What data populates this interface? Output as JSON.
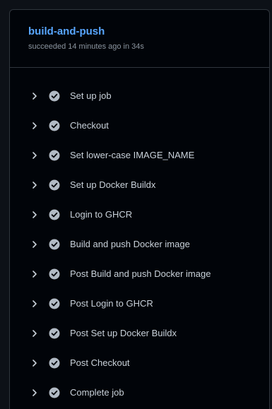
{
  "job": {
    "title": "build-and-push",
    "status": "succeeded 14 minutes ago in 34s"
  },
  "steps": [
    {
      "label": "Set up job",
      "status": "success",
      "icon": "check-circle-icon"
    },
    {
      "label": "Checkout",
      "status": "success",
      "icon": "check-circle-icon"
    },
    {
      "label": "Set lower-case IMAGE_NAME",
      "status": "success",
      "icon": "check-circle-icon"
    },
    {
      "label": "Set up Docker Buildx",
      "status": "success",
      "icon": "check-circle-icon"
    },
    {
      "label": "Login to GHCR",
      "status": "success",
      "icon": "check-circle-icon"
    },
    {
      "label": "Build and push Docker image",
      "status": "success",
      "icon": "check-circle-icon"
    },
    {
      "label": "Post Build and push Docker image",
      "status": "success",
      "icon": "check-circle-icon"
    },
    {
      "label": "Post Login to GHCR",
      "status": "success",
      "icon": "check-circle-icon"
    },
    {
      "label": "Post Set up Docker Buildx",
      "status": "success",
      "icon": "check-circle-icon"
    },
    {
      "label": "Post Checkout",
      "status": "success",
      "icon": "check-circle-icon"
    },
    {
      "label": "Complete job",
      "status": "success",
      "icon": "check-circle-icon"
    }
  ],
  "colors": {
    "background": "#0d1117",
    "panel": "#010409",
    "title": "#58a6ff",
    "muted": "#8b949e",
    "text": "#c9d1d9",
    "check_fill": "#b1bac4"
  }
}
